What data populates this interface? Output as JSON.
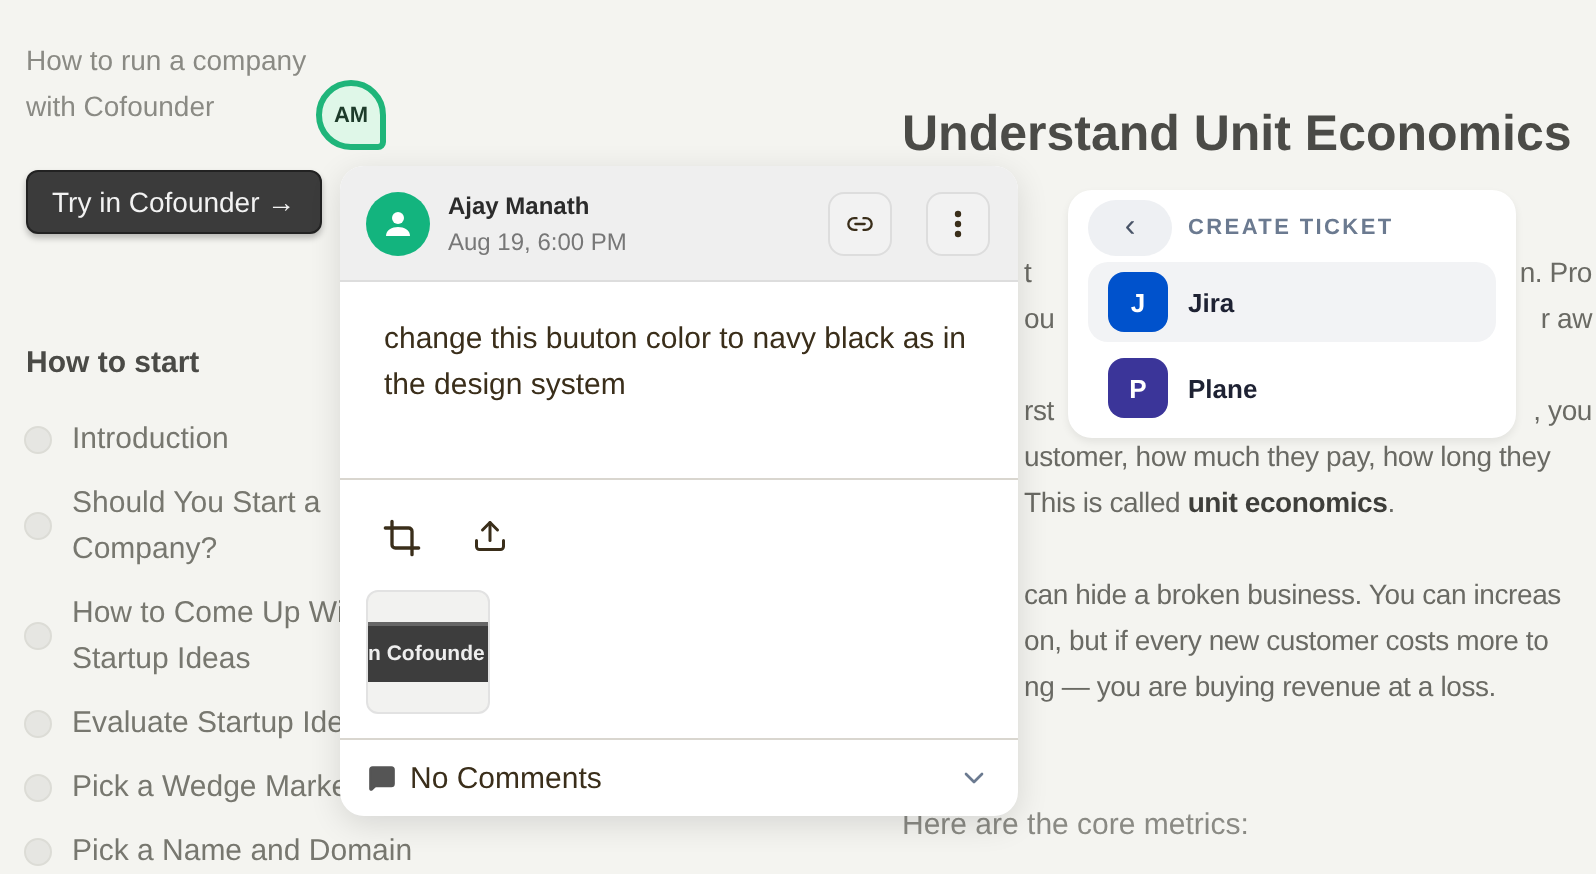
{
  "sidebar": {
    "title": "How to run a company with Cofounder",
    "avatar": "AM",
    "cta": "Try in Cofounder →",
    "section": "How to start",
    "items": [
      {
        "lines": [
          "Introduction"
        ]
      },
      {
        "lines": [
          "Should You Start a",
          "Company?"
        ]
      },
      {
        "lines": [
          "How to Come Up Wi",
          "Startup Ideas"
        ]
      },
      {
        "lines": [
          "Evaluate Startup Ide"
        ]
      },
      {
        "lines": [
          "Pick a Wedge Marke"
        ]
      },
      {
        "lines": [
          "Pick a Name and Domain"
        ]
      }
    ]
  },
  "article": {
    "title": "Understand Unit Economics",
    "paragraphs": [
      [
        {
          "left": "t",
          "right": "n. Pro"
        },
        {
          "left": "ou",
          "right": "r aw"
        }
      ],
      [
        {
          "left": "rst",
          "right": ", you"
        },
        {
          "left": "ustomer, how much they pay, how long they"
        },
        {
          "left": "This is called **unit economics**."
        }
      ],
      [
        {
          "left": "can hide a broken business. You can increas"
        },
        {
          "left": "on, but if every new customer costs more to"
        },
        {
          "left": "ng — you are buying revenue at a loss."
        }
      ]
    ],
    "footer": "Here are the core metrics:"
  },
  "comment": {
    "author": "Ajay Manath",
    "date": "Aug 19, 6:00 PM",
    "text": "change this buuton color to navy black as in the design system",
    "attachment": "n Cofounde",
    "comments_label": "No Comments"
  },
  "ticket_menu": {
    "title": "CREATE TICKET",
    "back": "‹",
    "items": [
      {
        "initial": "J",
        "name": "Jira",
        "color": "#0052cc",
        "selected": true
      },
      {
        "initial": "P",
        "name": "Plane",
        "color": "#3b3599",
        "selected": false
      }
    ]
  }
}
